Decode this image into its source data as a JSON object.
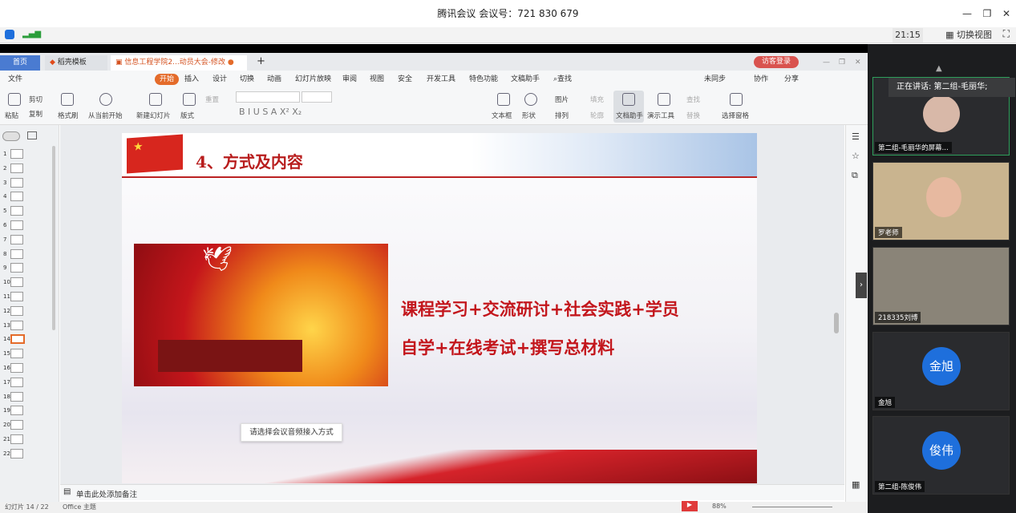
{
  "meeting": {
    "title": "腾讯会议 会议号：721 830 679",
    "time": "21:15",
    "switch_view": "切换视图",
    "speaking": "正在讲话: 第二组-毛丽华;"
  },
  "wps": {
    "tabs": {
      "home": "首页",
      "template": "稻壳模板",
      "doc": "信息工程学院2...动员大会-修改"
    },
    "login": "访客登录",
    "menu": [
      "文件",
      "开始",
      "插入",
      "设计",
      "切换",
      "动画",
      "幻灯片放映",
      "审阅",
      "视图",
      "安全",
      "开发工具",
      "特色功能",
      "文稿助手",
      "查找"
    ],
    "menu_right": [
      "未同步",
      "协作",
      "分享"
    ],
    "ribbon": [
      "粘贴",
      "剪切",
      "复制",
      "格式刷",
      "从当前开始",
      "新建幻灯片",
      "版式",
      "重置",
      "文本框",
      "形状",
      "图片",
      "排列",
      "填充",
      "轮廓",
      "文档助手",
      "演示工具",
      "查找",
      "替换",
      "选择窗格"
    ],
    "thumb_numbers": [
      "1",
      "2",
      "3",
      "4",
      "5",
      "6",
      "7",
      "8",
      "9",
      "10",
      "11",
      "12",
      "13",
      "14",
      "15",
      "16",
      "17",
      "18",
      "19",
      "20",
      "21",
      "22"
    ],
    "notes": "单击此处添加备注",
    "status_left": "幻灯片 14 / 22",
    "theme": "Office 主题",
    "zoom": "88%"
  },
  "slide": {
    "title": "4、方式及内容",
    "line1": "课程学习+交流研讨+社会实践+学员",
    "line2": "自学+在线考试+撰写总材料"
  },
  "tooltip": "请选择会议音频接入方式",
  "participants": [
    {
      "name": "第二组-毛丽华的屏幕..."
    },
    {
      "name": "罗老师"
    },
    {
      "name": "218335刘博"
    },
    {
      "name": "金旭",
      "avatar": "金旭"
    },
    {
      "name": "第二组-陈俊伟",
      "avatar": "俊伟"
    }
  ]
}
